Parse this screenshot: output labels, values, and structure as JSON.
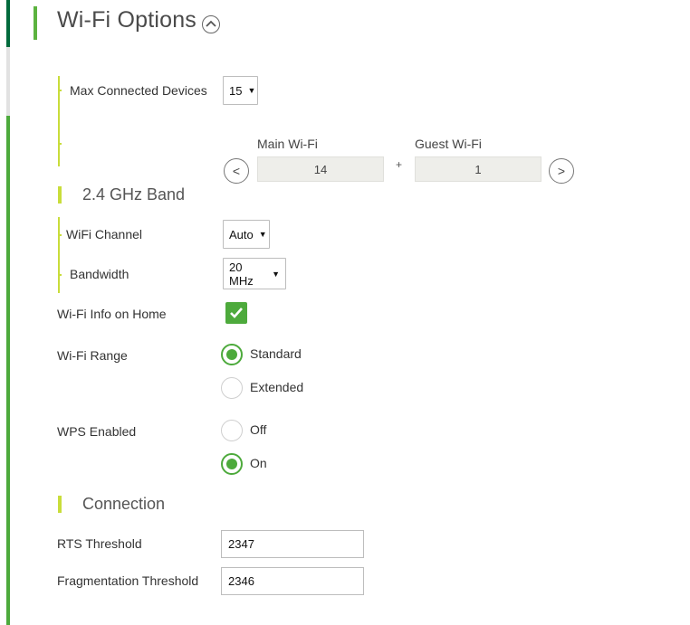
{
  "header": {
    "title": "Wi-Fi Options",
    "collapse_icon": "chevron-up-icon"
  },
  "max_devices": {
    "label": "Max Connected Devices",
    "value": "15",
    "split": {
      "main_label": "Main Wi-Fi",
      "main_value": "14",
      "plus": "+",
      "guest_label": "Guest Wi-Fi",
      "guest_value": "1",
      "decrease_label": "<",
      "increase_label": ">"
    }
  },
  "band_24": {
    "section_title": "2.4 GHz Band",
    "channel": {
      "label": "WiFi Channel",
      "value": "Auto"
    },
    "bandwidth": {
      "label": "Bandwidth",
      "value": "20 MHz"
    }
  },
  "wifi_info_home": {
    "label": "Wi-Fi Info on Home",
    "checked": true
  },
  "wifi_range": {
    "label": "Wi-Fi Range",
    "options": [
      {
        "label": "Standard",
        "selected": true
      },
      {
        "label": "Extended",
        "selected": false
      }
    ]
  },
  "wps": {
    "label": "WPS Enabled",
    "options": [
      {
        "label": "Off",
        "selected": false
      },
      {
        "label": "On",
        "selected": true
      }
    ]
  },
  "connection": {
    "section_title": "Connection",
    "rts": {
      "label": "RTS Threshold",
      "value": "2347"
    },
    "fragmentation": {
      "label": "Fragmentation Threshold",
      "value": "2346"
    }
  },
  "colors": {
    "accent_green": "#4daa3c",
    "dark_green": "#006a3c",
    "lime": "#c9dd3b"
  }
}
